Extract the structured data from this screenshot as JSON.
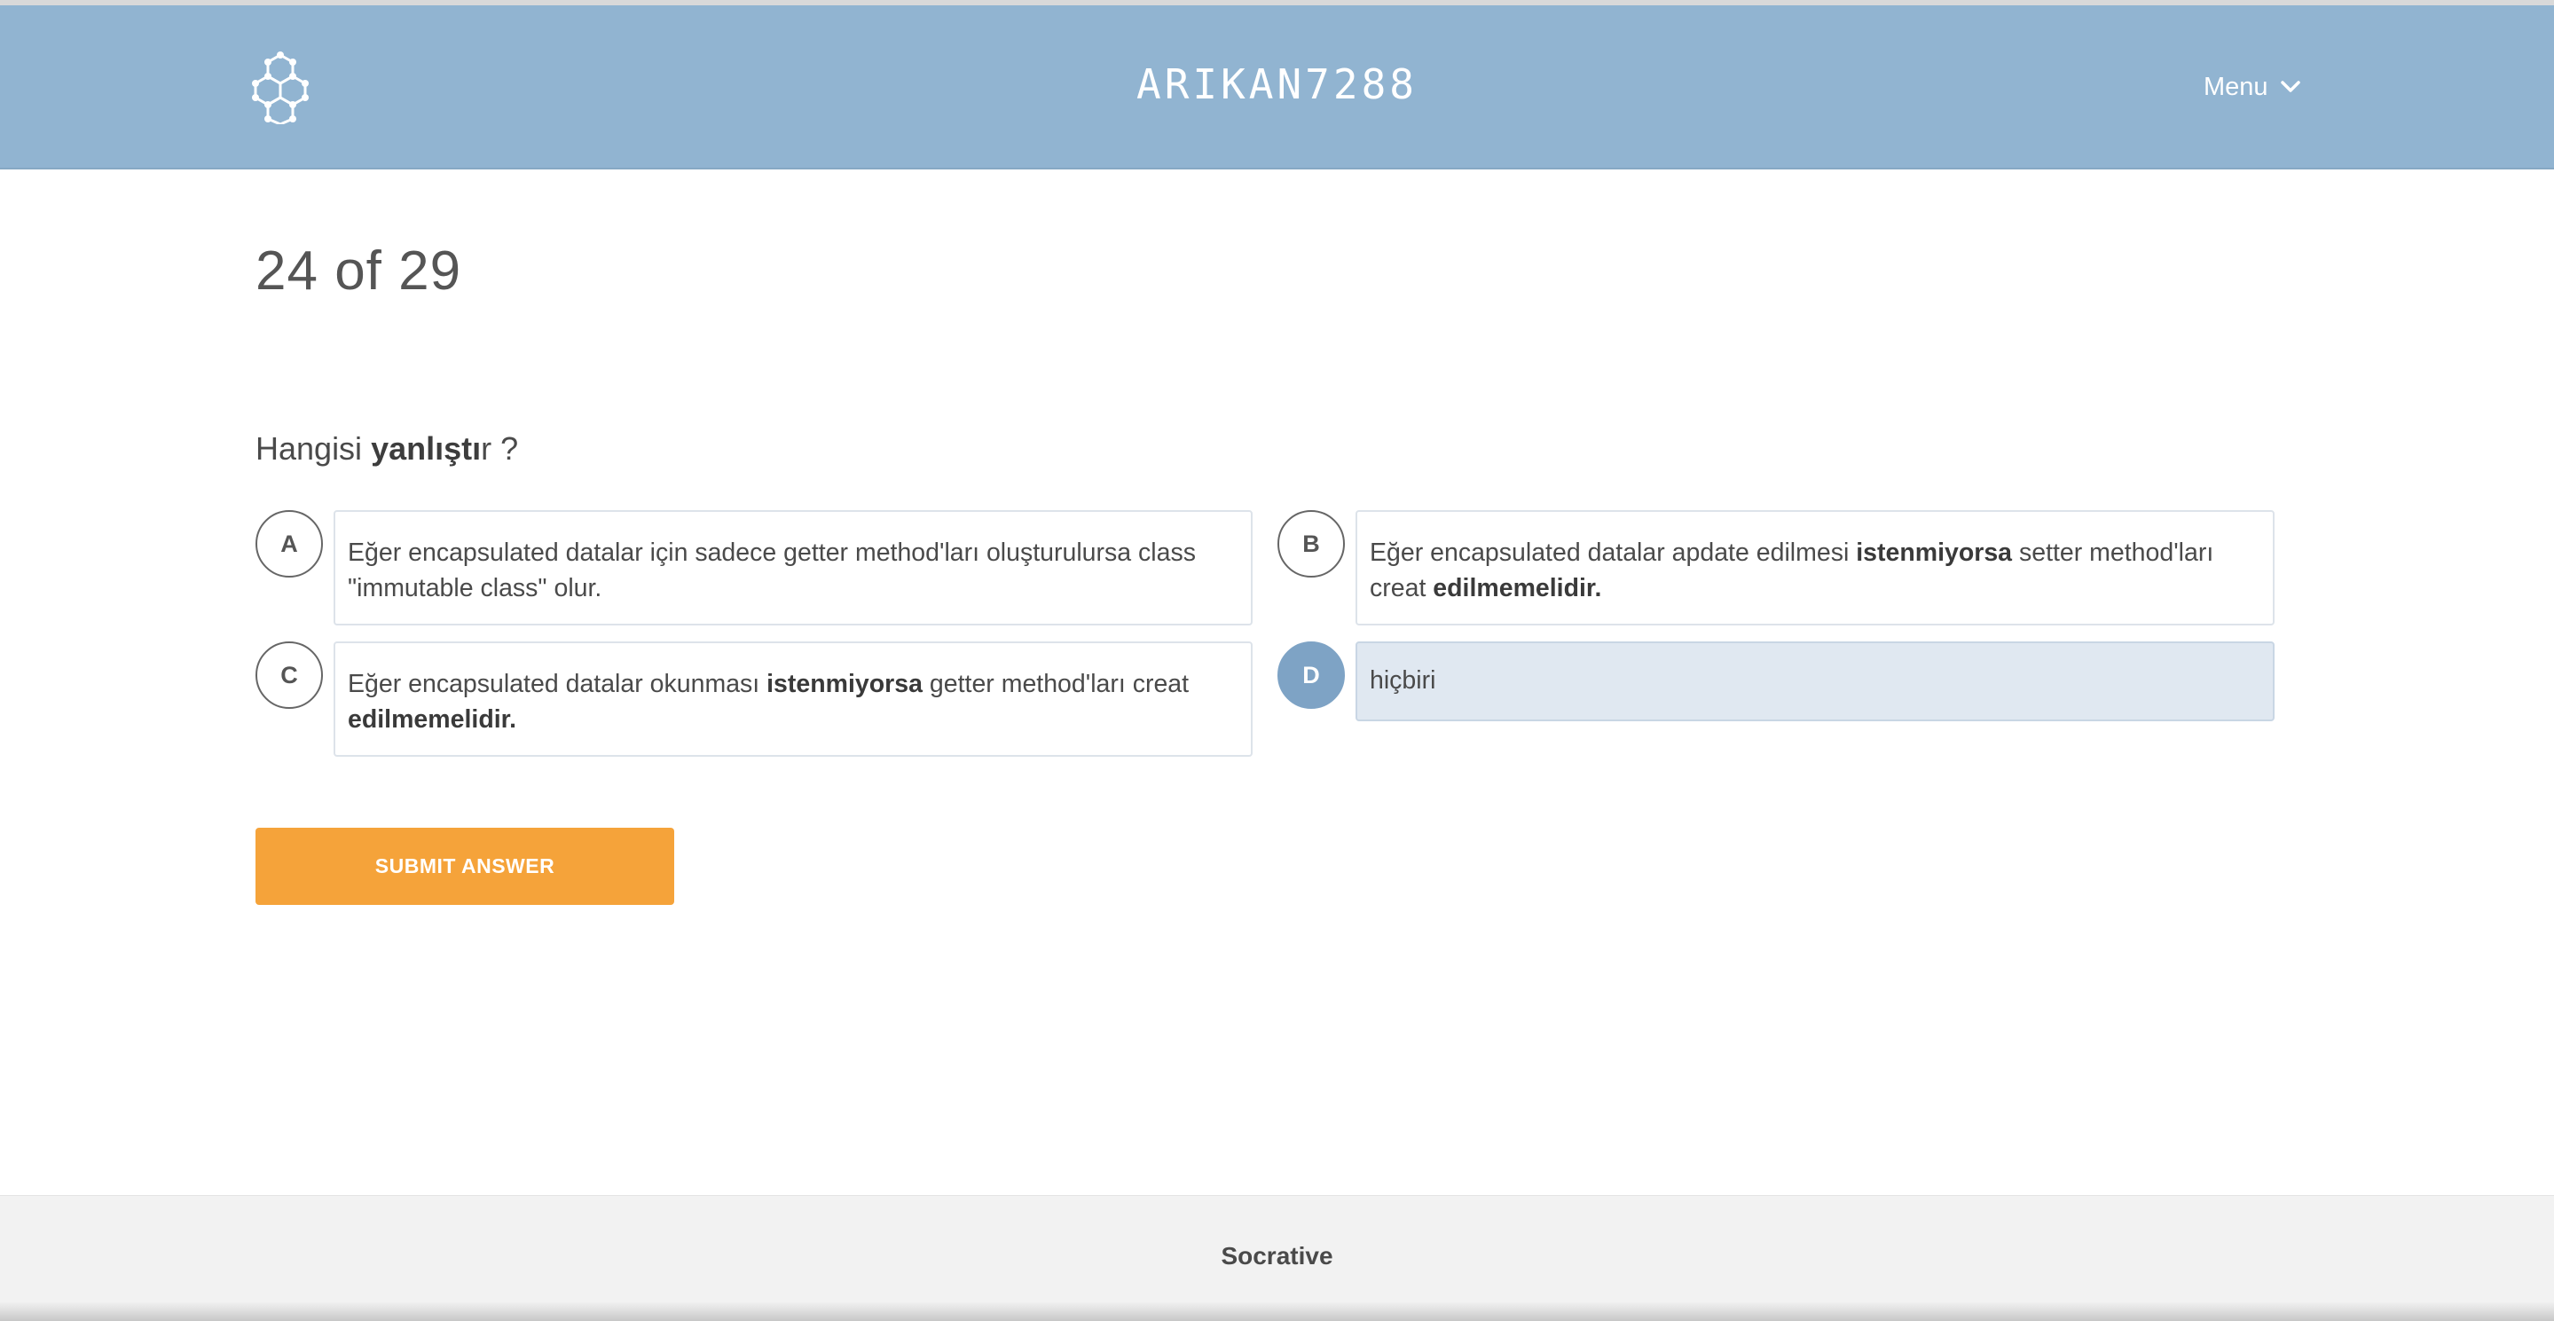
{
  "header": {
    "room_name": "ARIKAN7288",
    "menu_label": "Menu",
    "logo_icon": "hexagon-cluster-icon",
    "background_color": "#91b4d1"
  },
  "progress": {
    "text": "24 of 29",
    "current": 24,
    "total": 29
  },
  "question": {
    "prefix": "Hangisi ",
    "bold": "yanlıştı",
    "suffix": "r ?"
  },
  "options": [
    {
      "letter": "A",
      "parts": [
        {
          "text": "Eğer encapsulated datalar için sadece getter method'ları oluşturulursa class \"immutable class\" olur.",
          "bold": false
        }
      ],
      "selected": false
    },
    {
      "letter": "B",
      "parts": [
        {
          "text": "Eğer encapsulated datalar apdate edilmesi ",
          "bold": false
        },
        {
          "text": "istenmiyorsa",
          "bold": true
        },
        {
          "text": " setter method'ları creat ",
          "bold": false
        },
        {
          "text": "edilmemelidir.",
          "bold": true
        }
      ],
      "selected": false
    },
    {
      "letter": "C",
      "parts": [
        {
          "text": "Eğer encapsulated datalar okunması  ",
          "bold": false
        },
        {
          "text": "istenmiyorsa",
          "bold": true
        },
        {
          "text": " getter method'ları creat ",
          "bold": false
        },
        {
          "text": "edilmemelidir.",
          "bold": true
        }
      ],
      "selected": false
    },
    {
      "letter": "D",
      "parts": [
        {
          "text": "hiçbiri",
          "bold": false
        }
      ],
      "selected": true
    }
  ],
  "submit_label": "SUBMIT ANSWER",
  "footer": {
    "brand": "Socrative"
  },
  "colors": {
    "accent_orange": "#f5a33a",
    "selected_blue": "#7ea3c5",
    "selected_bg": "#e0e8f1"
  }
}
